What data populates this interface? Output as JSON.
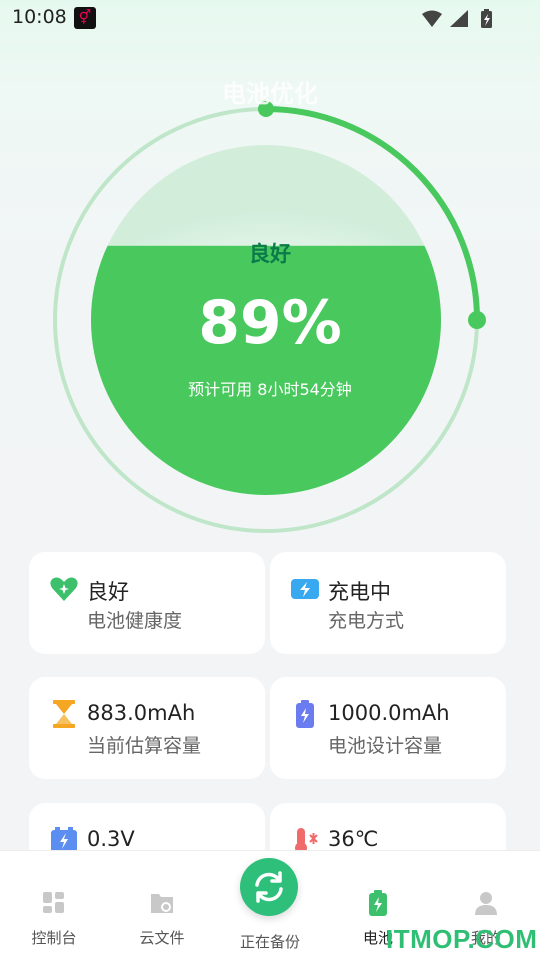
{
  "status_bar": {
    "time": "10:08"
  },
  "gauge": {
    "title": "电池优化",
    "health": "良好",
    "percent": "89%",
    "level": 0.89,
    "estimate": "预计可用 8小时54分钟",
    "accent": "#48c85d"
  },
  "cards": [
    {
      "value": "良好",
      "label": "电池健康度",
      "icon": "heart-icon"
    },
    {
      "value": "充电中",
      "label": "充电方式",
      "icon": "charging-icon"
    },
    {
      "value": "883.0mAh",
      "label": "当前估算容量",
      "icon": "hourglass-icon"
    },
    {
      "value": "1000.0mAh",
      "label": "电池设计容量",
      "icon": "battery-icon"
    },
    {
      "value": "0.3V",
      "label": "",
      "icon": "voltage-icon"
    },
    {
      "value": "36℃",
      "label": "",
      "icon": "temperature-icon"
    }
  ],
  "nav": {
    "items": [
      {
        "label": "控制台",
        "icon": "dashboard-icon"
      },
      {
        "label": "云文件",
        "icon": "cloud-folder-icon"
      },
      {
        "label": "正在备份",
        "icon": "sync-icon"
      },
      {
        "label": "电池",
        "icon": "battery-nav-icon"
      },
      {
        "label": "我的",
        "icon": "profile-icon"
      }
    ]
  },
  "watermark": "ITMOP.COM"
}
